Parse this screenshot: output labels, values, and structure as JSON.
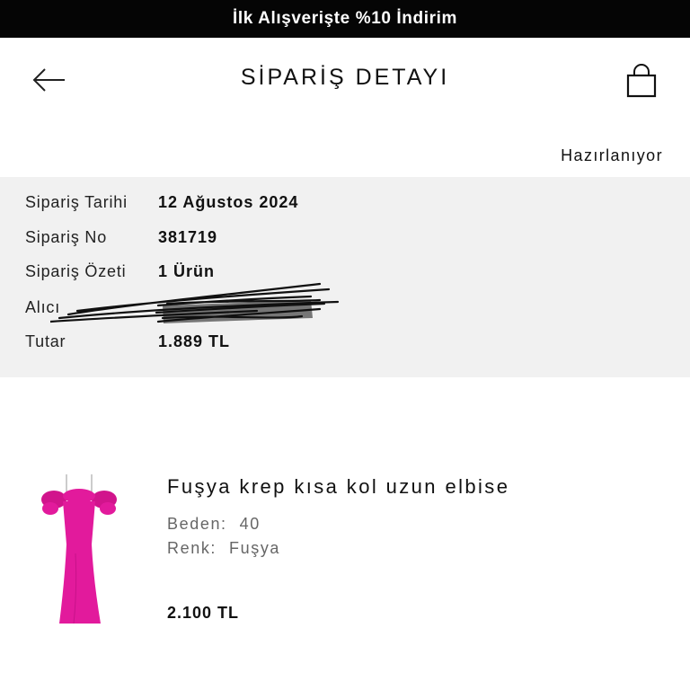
{
  "promo": {
    "text": "İlk Alışverişte %10 İndirim"
  },
  "header": {
    "title": "SİPARİŞ DETAYI",
    "back_icon": "arrow-left-icon",
    "bag_icon": "shopping-bag-icon"
  },
  "order": {
    "status": "Hazırlanıyor",
    "rows": [
      {
        "label": "Sipariş Tarihi",
        "value": "12 Ağustos 2024"
      },
      {
        "label": "Sipariş No",
        "value": "381719"
      },
      {
        "label": "Sipariş Özeti",
        "value": "1 Ürün"
      },
      {
        "label": "Alıcı",
        "value": ""
      },
      {
        "label": "Tutar",
        "value": "1.889 TL"
      }
    ]
  },
  "product": {
    "name": "Fuşya krep kısa kol uzun elbise",
    "size_label": "Beden:",
    "size_value": "40",
    "color_label": "Renk:",
    "color_value": "Fuşya",
    "price": "2.100 TL",
    "dress_color": "#e21a9c"
  }
}
